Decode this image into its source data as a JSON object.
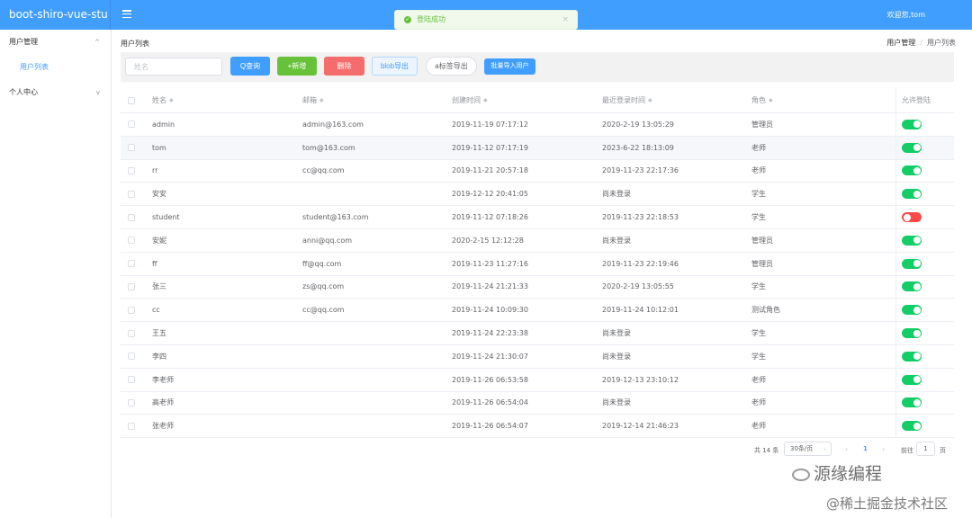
{
  "header": {
    "brand": "boot-shiro-vue-stu",
    "welcome": "欢迎您,tom"
  },
  "toast": {
    "text": "登陆成功",
    "ok_icon": "✓",
    "close_icon": "×"
  },
  "sidebar": {
    "groups": [
      {
        "label": "用户管理",
        "chevron": "^",
        "children": [
          "用户列表"
        ]
      },
      {
        "label": "个人中心",
        "chevron": "v"
      }
    ]
  },
  "main": {
    "title": "用户列表",
    "breadcrumb": [
      "用户管理",
      "/",
      "用户列表"
    ]
  },
  "toolbar": {
    "search_placeholder": "姓名",
    "query_label": "Q查询",
    "add_label": "+新增",
    "delete_label": "删除",
    "blob_export_label": "blob导出",
    "a_export_label": "a标签导出",
    "import_label": "批量导入用户"
  },
  "table": {
    "headers": [
      "姓名",
      "邮箱",
      "创建时间",
      "最近登录时间",
      "角色",
      "允许登陆"
    ],
    "sort_icon": "◆",
    "rows": [
      {
        "name": "admin",
        "email": "admin@163.com",
        "created": "2019-11-19 07:17:12",
        "last_login": "2020-2-19 13:05:29",
        "role": "管理员",
        "allow": true
      },
      {
        "name": "tom",
        "email": "tom@163.com",
        "created": "2019-11-12 07:17:19",
        "last_login": "2023-6-22 18:13:09",
        "role": "老师",
        "allow": true
      },
      {
        "name": "rr",
        "email": "cc@qq.com",
        "created": "2019-11-21 20:57:18",
        "last_login": "2019-11-23 22:17:36",
        "role": "老师",
        "allow": true
      },
      {
        "name": "安安",
        "email": "",
        "created": "2019-12-12 20:41:05",
        "last_login": "尚未登录",
        "role": "学生",
        "allow": true
      },
      {
        "name": "student",
        "email": "student@163.com",
        "created": "2019-11-12 07:18:26",
        "last_login": "2019-11-23 22:18:53",
        "role": "学生",
        "allow": false
      },
      {
        "name": "安妮",
        "email": "anni@qq.com",
        "created": "2020-2-15 12:12:28",
        "last_login": "尚未登录",
        "role": "管理员",
        "allow": true
      },
      {
        "name": "ff",
        "email": "ff@qq.com",
        "created": "2019-11-23 11:27:16",
        "last_login": "2019-11-23 22:19:46",
        "role": "管理员",
        "allow": true
      },
      {
        "name": "张三",
        "email": "zs@qq.com",
        "created": "2019-11-24 21:21:33",
        "last_login": "2020-2-19 13:05:55",
        "role": "学生",
        "allow": true
      },
      {
        "name": "cc",
        "email": "cc@qq.com",
        "created": "2019-11-24 10:09:30",
        "last_login": "2019-11-24 10:12:01",
        "role": "测试角色",
        "allow": true
      },
      {
        "name": "王五",
        "email": "",
        "created": "2019-11-24 22:23:38",
        "last_login": "尚未登录",
        "role": "学生",
        "allow": true
      },
      {
        "name": "李四",
        "email": "",
        "created": "2019-11-24 21:30:07",
        "last_login": "尚未登录",
        "role": "学生",
        "allow": true
      },
      {
        "name": "李老师",
        "email": "",
        "created": "2019-11-26 06:53:58",
        "last_login": "2019-12-13 23:10:12",
        "role": "老师",
        "allow": true
      },
      {
        "name": "高老师",
        "email": "",
        "created": "2019-11-26 06:54:04",
        "last_login": "尚未登录",
        "role": "老师",
        "allow": true
      },
      {
        "name": "张老师",
        "email": "",
        "created": "2019-11-26 06:54:07",
        "last_login": "2019-12-14 21:46:23",
        "role": "老师",
        "allow": true
      }
    ]
  },
  "pager": {
    "total": "共 14 条",
    "page_size": "30条/页",
    "dropdown_icon": "⌄",
    "prev_icon": "‹",
    "current_page": "1",
    "next_icon": "›",
    "goto_label": "前往",
    "goto_value": "1",
    "unit": "页"
  },
  "watermark": {
    "line1": "源缘编程",
    "line2": "@稀土掘金技术社区"
  },
  "colors": {
    "primary": "#409eff",
    "success": "#67c23a",
    "danger": "#f56c6c",
    "switch_on": "#13ce66",
    "switch_off": "#ff4949"
  }
}
